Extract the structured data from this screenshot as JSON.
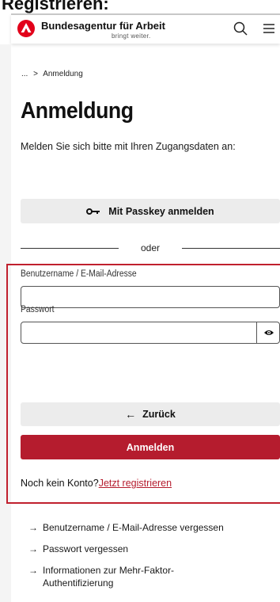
{
  "page_caption": "Registrieren:",
  "header": {
    "brand_name": "Bundesagentur für Arbeit",
    "brand_claim": "bringt weiter.",
    "logo_icon": "ba-logo-icon",
    "search_icon": "search-icon",
    "menu_icon": "hamburger-menu-icon",
    "brand_color": "#e2001a"
  },
  "breadcrumb": {
    "ellipsis": "...",
    "separator": ">",
    "current": "Anmeldung"
  },
  "main": {
    "title": "Anmeldung",
    "intro": "Melden Sie sich bitte mit Ihren Zugangsdaten an:",
    "passkey_label": "Mit Passkey anmelden",
    "passkey_icon": "key-icon",
    "divider_text": "oder"
  },
  "form": {
    "username_label": "Benutzername / E-Mail-Adresse",
    "username_value": "",
    "password_label": "Passwort",
    "password_value": "",
    "show_password_icon": "eye-icon",
    "back_arrow": "←",
    "back_label": "Zurück",
    "submit_label": "Anmelden",
    "no_account_text": "Noch kein Konto?",
    "register_link": "Jetzt registrieren",
    "highlight_color": "#c0202e",
    "accent_color": "#b51c2e"
  },
  "help_links": [
    {
      "arrow": "→",
      "label": "Benutzername / E-Mail-Adresse vergessen"
    },
    {
      "arrow": "→",
      "label": "Passwort vergessen"
    },
    {
      "arrow": "→",
      "label": "Informationen zur Mehr-Faktor-Authentifizierung"
    }
  ]
}
